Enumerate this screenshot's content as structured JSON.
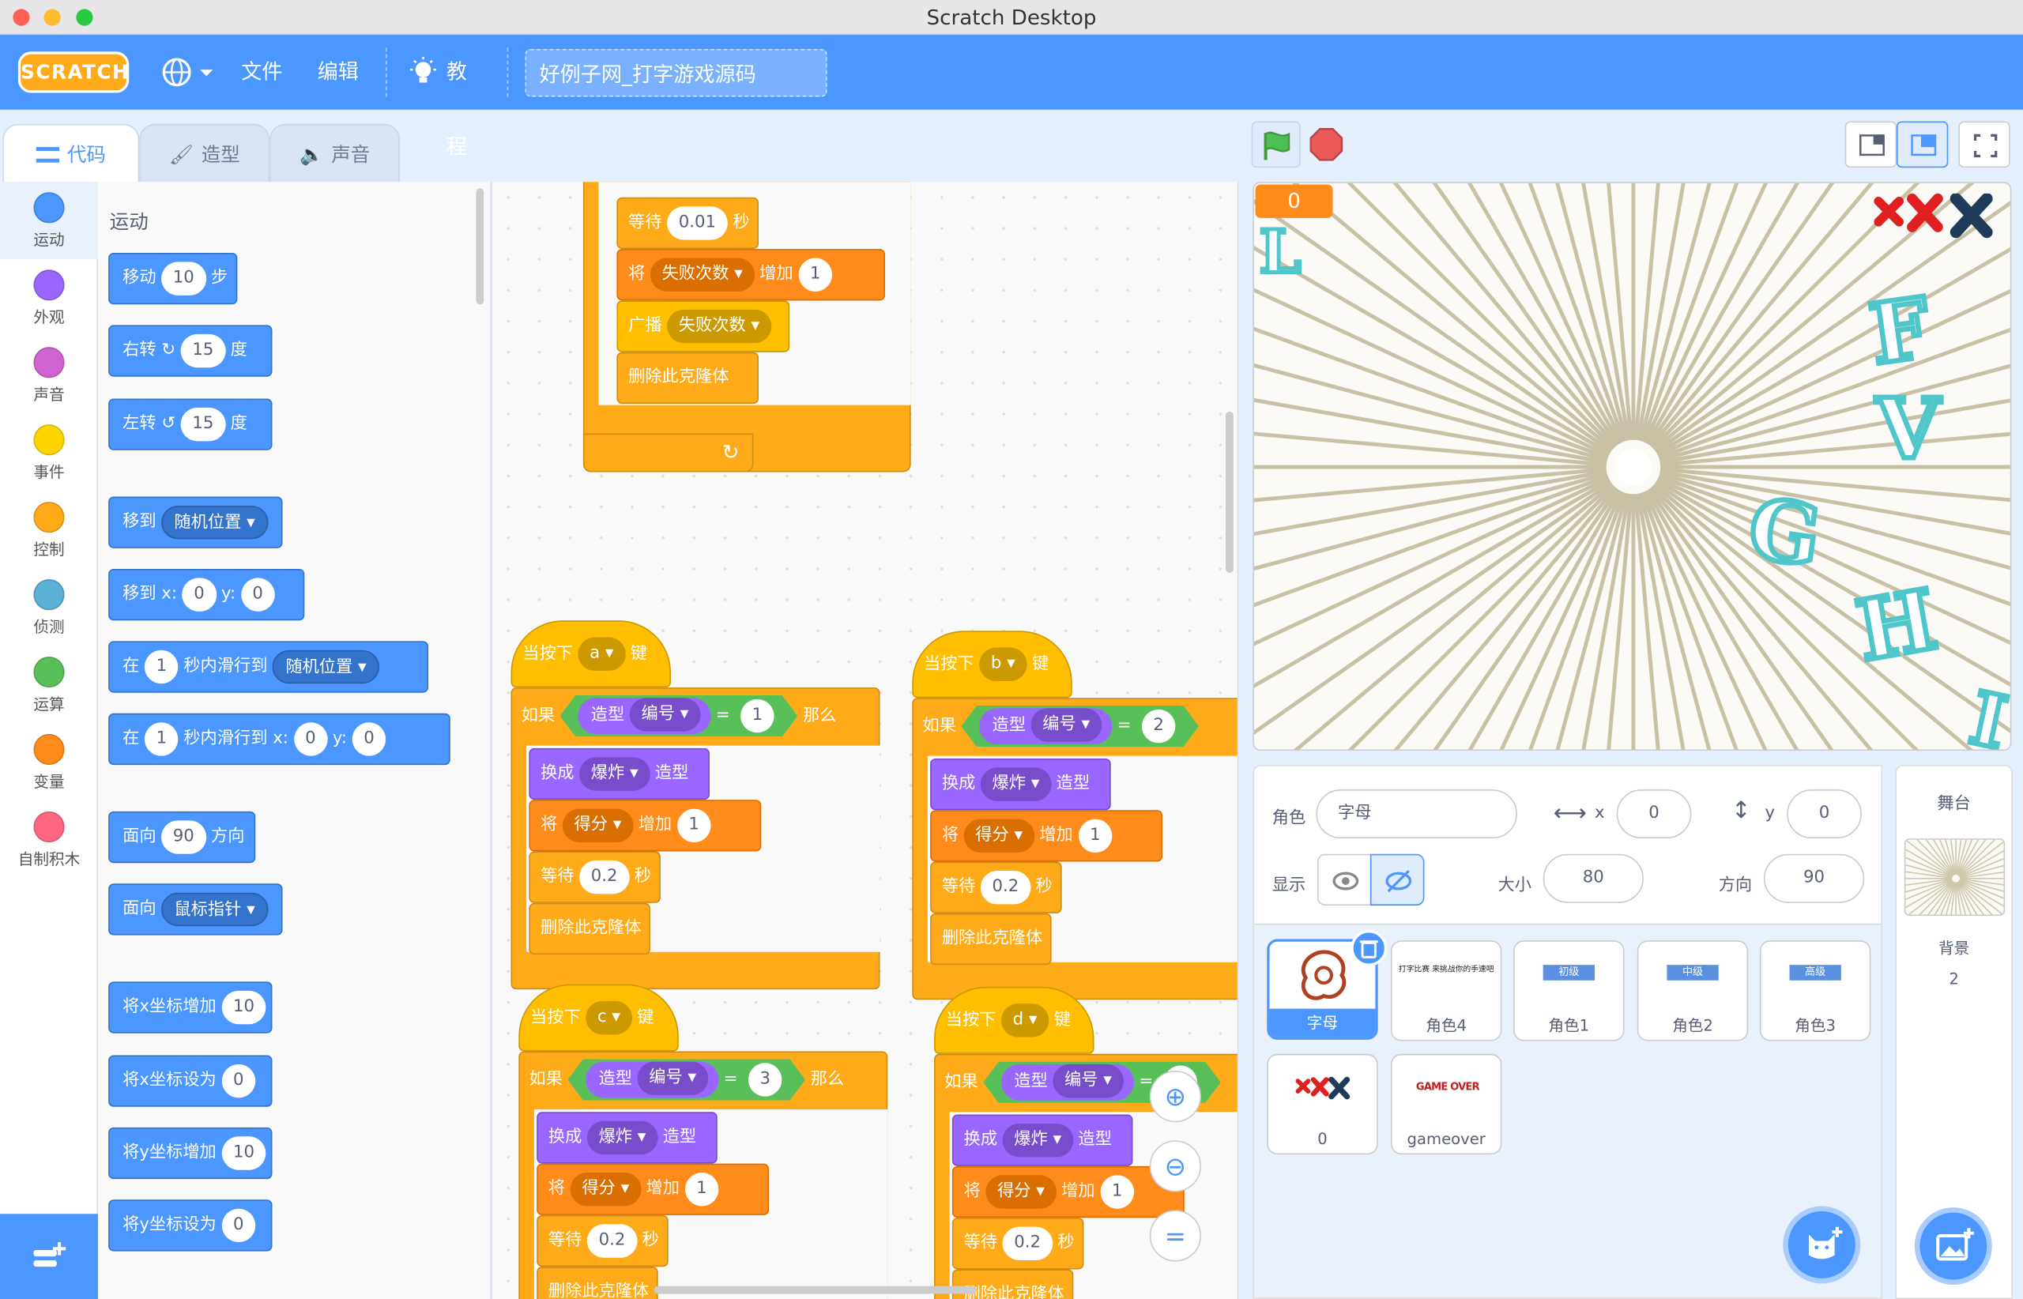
{
  "window": {
    "title": "Scratch Desktop"
  },
  "menubar": {
    "file": "文件",
    "edit": "编辑",
    "tutorials": "教程",
    "project_title": "好例子网_打字游戏源码"
  },
  "tabs": {
    "code": "代码",
    "costumes": "造型",
    "sounds": "声音"
  },
  "categories": [
    "运动",
    "外观",
    "声音",
    "事件",
    "控制",
    "侦测",
    "运算",
    "变量",
    "自制积木"
  ],
  "category_colors": [
    "#4c97ff",
    "#9966ff",
    "#cf63cf",
    "#ffd500",
    "#ffab19",
    "#5cb1d6",
    "#59c059",
    "#ff8c1a",
    "#ff6680"
  ],
  "palette": {
    "heading": "运动",
    "move": {
      "a": "移动",
      "v": "10",
      "b": "步"
    },
    "turn_right": {
      "a": "右转",
      "v": "15",
      "b": "度"
    },
    "turn_left": {
      "a": "左转",
      "v": "15",
      "b": "度"
    },
    "goto": {
      "a": "移到",
      "dd": "随机位置"
    },
    "gotoxy": {
      "a": "移到 x:",
      "x": "0",
      "b": "y:",
      "y": "0"
    },
    "glide": {
      "a": "在",
      "v": "1",
      "b": "秒内滑行到",
      "dd": "随机位置"
    },
    "glidexy": {
      "a": "在",
      "v": "1",
      "b": "秒内滑行到 x:",
      "x": "0",
      "c": "y:",
      "y": "0"
    },
    "point": {
      "a": "面向",
      "v": "90",
      "b": "方向"
    },
    "pointto": {
      "a": "面向",
      "dd": "鼠标指针"
    },
    "changex": {
      "a": "将x坐标增加",
      "v": "10"
    },
    "setx": {
      "a": "将x坐标设为",
      "v": "0"
    },
    "changey": {
      "a": "将y坐标增加",
      "v": "10"
    },
    "sety": {
      "a": "将y坐标设为",
      "v": "0"
    }
  },
  "code": {
    "wait": "等待",
    "sec": "秒",
    "wait_v": "0.01",
    "set": "将",
    "change": "增加",
    "fail_var": "失败次数",
    "one": "1",
    "broadcast": "广播",
    "delete": "删除此克隆体",
    "when_key": "当按下",
    "key": "键",
    "if": "如果",
    "then": "那么",
    "costume": "造型",
    "number": "编号",
    "eq": "=",
    "switch": "换成",
    "explode": "爆炸",
    "score": "得分",
    "wait2": "0.2",
    "keys": [
      "a",
      "b",
      "c",
      "d"
    ],
    "values": [
      "1",
      "2",
      "3",
      "4"
    ]
  },
  "stage": {
    "score": "0",
    "letters": [
      "L",
      "F",
      "V",
      "G",
      "H",
      "I"
    ]
  },
  "sprite_info": {
    "sprite_label": "角色",
    "sprite_name": "字母",
    "x_label": "x",
    "x": "0",
    "y_label": "y",
    "y": "0",
    "show_label": "显示",
    "size_label": "大小",
    "size": "80",
    "direction_label": "方向",
    "direction": "90"
  },
  "sprites": [
    {
      "name": "字母",
      "thumb": ""
    },
    {
      "name": "角色4",
      "thumb": "打字比赛 来挑战你的手速吧"
    },
    {
      "name": "角色1",
      "thumb": "初级"
    },
    {
      "name": "角色2",
      "thumb": "中级"
    },
    {
      "name": "角色3",
      "thumb": "高级"
    },
    {
      "name": "0",
      "thumb": ""
    },
    {
      "name": "gameover",
      "thumb": "GAME OVER"
    }
  ],
  "stage_panel": {
    "title": "舞台",
    "backdrop_label": "背景",
    "backdrop_count": "2"
  }
}
